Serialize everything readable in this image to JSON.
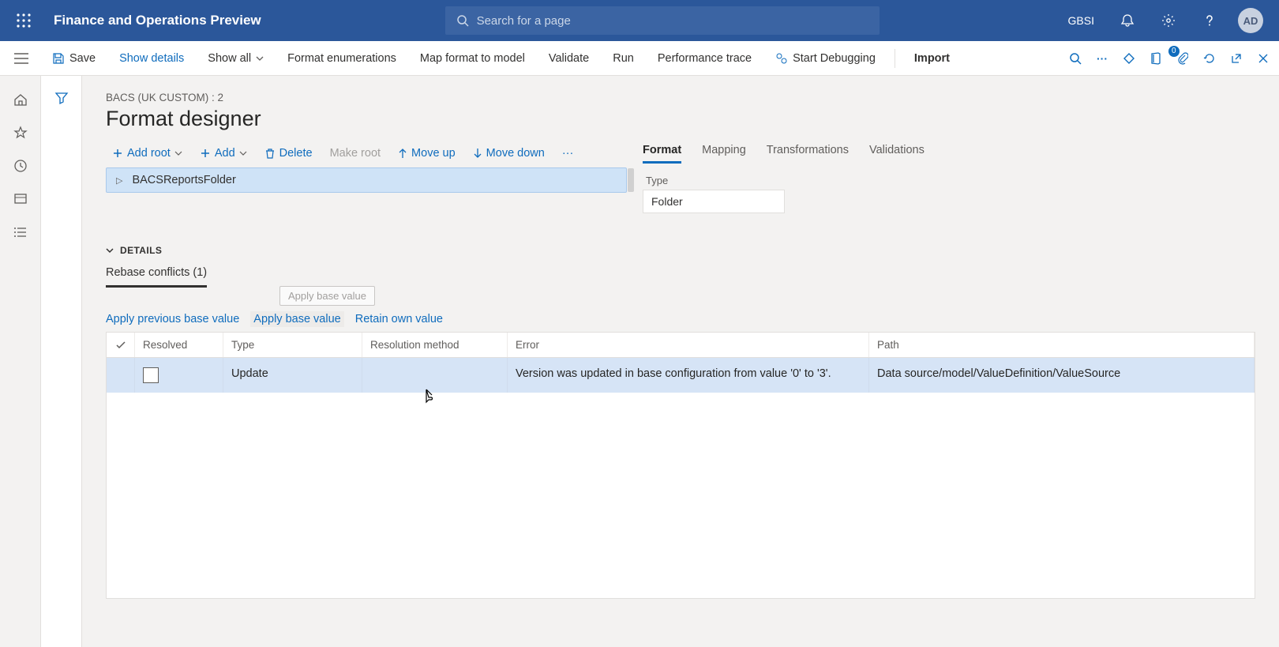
{
  "header": {
    "brand": "Finance and Operations Preview",
    "search_placeholder": "Search for a page",
    "company": "GBSI",
    "avatar_initials": "AD"
  },
  "commandBar": {
    "save": "Save",
    "show_details": "Show details",
    "show_all": "Show all",
    "format_enum": "Format enumerations",
    "map_format": "Map format to model",
    "validate": "Validate",
    "run": "Run",
    "perf_trace": "Performance trace",
    "start_debug": "Start Debugging",
    "import": "Import",
    "badge_count": "0"
  },
  "page": {
    "breadcrumb": "BACS (UK CUSTOM) : 2",
    "title": "Format designer"
  },
  "toolbar": {
    "add_root": "Add root",
    "add": "Add",
    "delete": "Delete",
    "make_root": "Make root",
    "move_up": "Move up",
    "move_down": "Move down"
  },
  "tree": {
    "node0": "BACSReportsFolder"
  },
  "rightTabs": {
    "format": "Format",
    "mapping": "Mapping",
    "transformations": "Transformations",
    "validations": "Validations",
    "prop_type_label": "Type",
    "prop_type_value": "Folder"
  },
  "details": {
    "heading": "DETAILS",
    "tab": "Rebase conflicts (1)",
    "tooltip": "Apply base value",
    "actions": {
      "apply_prev": "Apply previous base value",
      "apply_base": "Apply base value",
      "retain_own": "Retain own value"
    },
    "columns": {
      "resolved": "Resolved",
      "type": "Type",
      "resolution": "Resolution method",
      "error": "Error",
      "path": "Path"
    },
    "rows": [
      {
        "resolved": false,
        "type": "Update",
        "resolution": "",
        "error": "Version was updated in base configuration from value '0' to '3'.",
        "path": "Data source/model/ValueDefinition/ValueSource"
      }
    ]
  }
}
